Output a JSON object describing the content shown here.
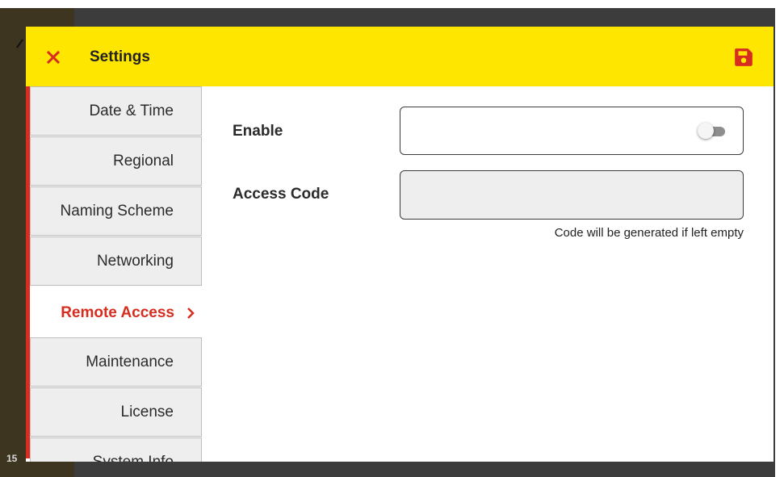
{
  "background": {
    "bottom_text": "15"
  },
  "header": {
    "title": "Settings",
    "close_icon": "close-icon",
    "save_icon": "save-icon",
    "color": "#ffe600"
  },
  "sidebar": {
    "accent_color": "#d62d20",
    "items": [
      {
        "label": "Date & Time",
        "active": false
      },
      {
        "label": "Regional",
        "active": false
      },
      {
        "label": "Naming Scheme",
        "active": false
      },
      {
        "label": "Networking",
        "active": false
      },
      {
        "label": "Remote Access",
        "active": true
      },
      {
        "label": "Maintenance",
        "active": false
      },
      {
        "label": "License",
        "active": false
      },
      {
        "label": "System Info",
        "active": false
      }
    ]
  },
  "main": {
    "enable": {
      "label": "Enable",
      "value": false
    },
    "access_code": {
      "label": "Access Code",
      "value": "",
      "hint": "Code will be generated if left empty"
    }
  }
}
